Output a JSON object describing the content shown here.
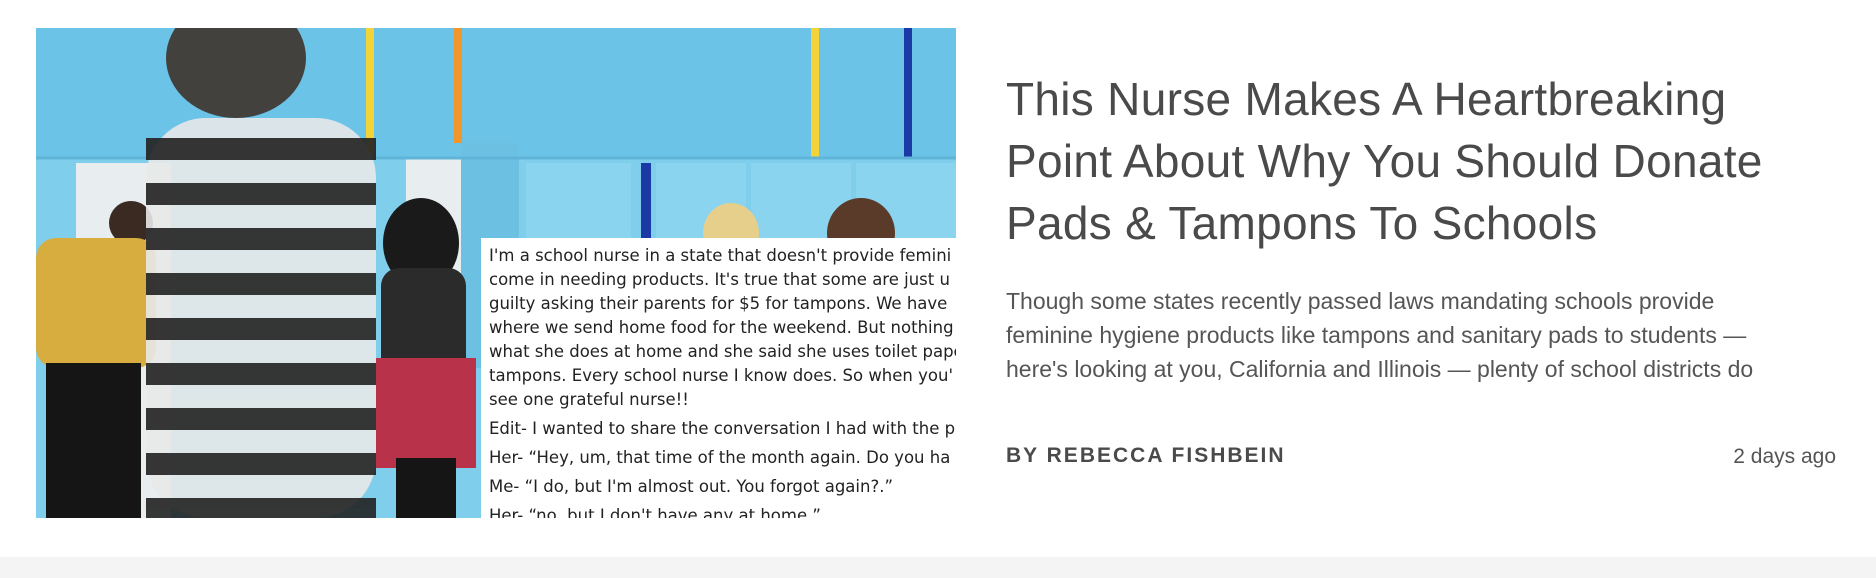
{
  "article": {
    "title_lines": [
      "This Nurse Makes A Heartbreaking",
      "Point About Why You Should Donate",
      "Pads & Tampons To Schools"
    ],
    "excerpt_lines": [
      "Though some states recently passed laws mandating schools provide",
      "feminine hygiene products like tampons and sanitary pads to students —",
      "here's looking at you, California and Illinois — plenty of school districts do"
    ],
    "byline_prefix": "BY",
    "author": "REBECCA FISHBEIN",
    "date": "2 days ago"
  },
  "image_overlay": {
    "lines": [
      "I'm a school nurse in a state that doesn't provide femini",
      "come in needing products. It's true that some are just u",
      "guilty asking their parents for $5 for tampons. We have",
      "where we send home food for the weekend. But nothing",
      "what she does at home and she said she uses toilet pape",
      "tampons. Every school nurse I know does. So when you'",
      "see one grateful nurse!!"
    ],
    "dialogue": [
      "Edit- I wanted to share the conversation I had with the p",
      "Her- “Hey, um, that time of the month again. Do you ha",
      "Me- “I do, but I'm almost out. You forgot again?.”",
      "Her- “no, but I don't have any at home.”"
    ]
  }
}
